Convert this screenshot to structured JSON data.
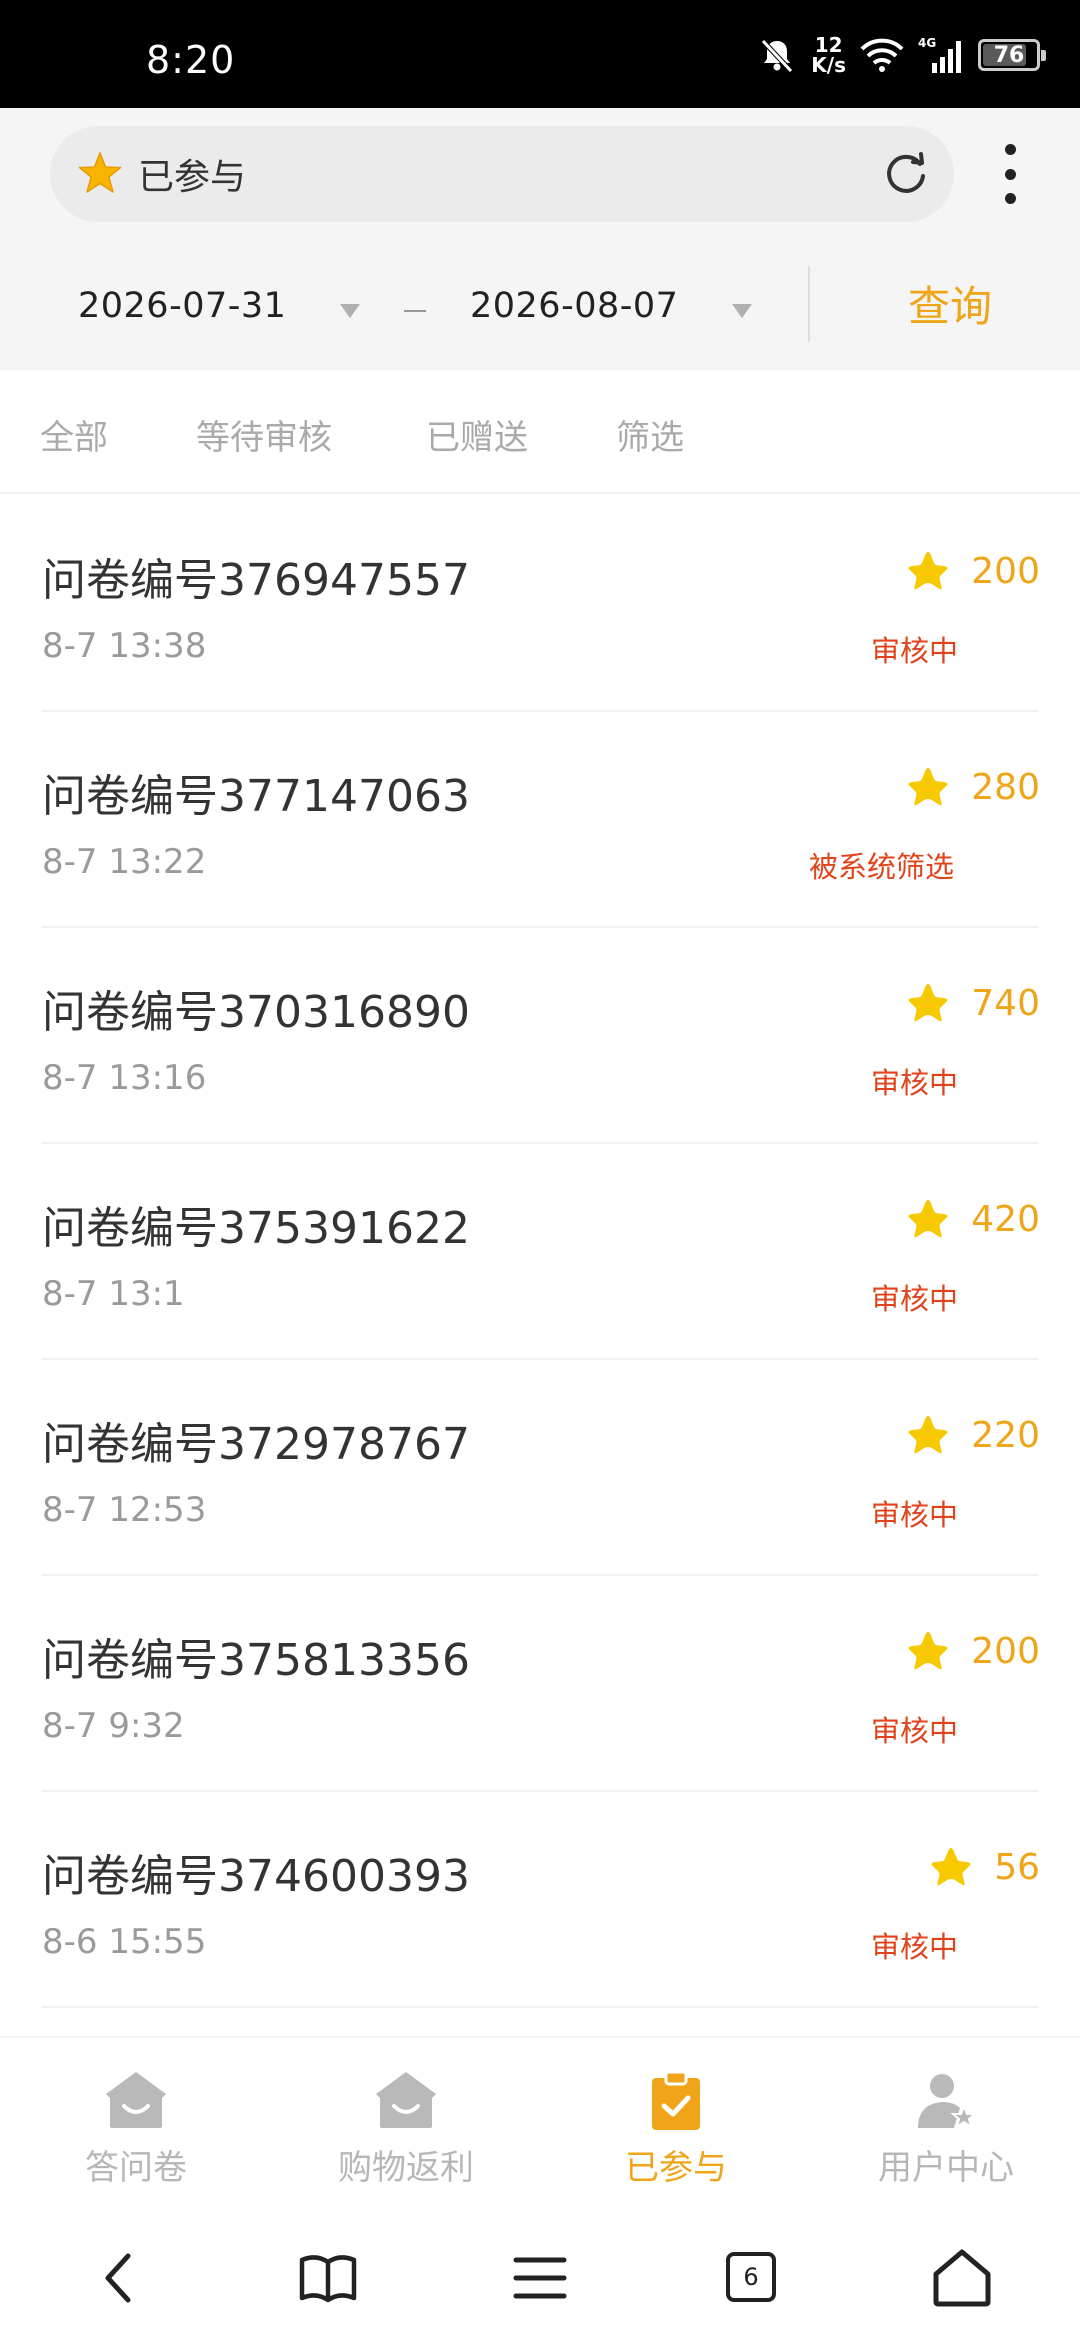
{
  "status_bar": {
    "time": "8:20",
    "net_speed_value": "12",
    "net_speed_unit": "K/s",
    "network": "4G",
    "battery": "76"
  },
  "header": {
    "title": "已参与",
    "title_icon": "star-icon",
    "refresh_icon": "refresh-icon",
    "more_icon": "more-vertical-icon"
  },
  "date_filter": {
    "start": "2026-07-31",
    "end": "2026-08-07",
    "separator": "–",
    "query_label": "查询"
  },
  "tabs": [
    {
      "label": "全部"
    },
    {
      "label": "等待审核"
    },
    {
      "label": "已赠送"
    },
    {
      "label": "筛选"
    }
  ],
  "items": [
    {
      "title": "问卷编号376947557",
      "time": "8-7 13:38",
      "points": "200",
      "status": "审核中"
    },
    {
      "title": "问卷编号377147063",
      "time": "8-7 13:22",
      "points": "280",
      "status": "被系统筛选"
    },
    {
      "title": "问卷编号370316890",
      "time": "8-7 13:16",
      "points": "740",
      "status": "审核中"
    },
    {
      "title": "问卷编号375391622",
      "time": "8-7 13:1",
      "points": "420",
      "status": "审核中"
    },
    {
      "title": "问卷编号372978767",
      "time": "8-7 12:53",
      "points": "220",
      "status": "审核中"
    },
    {
      "title": "问卷编号375813356",
      "time": "8-7 9:32",
      "points": "200",
      "status": "审核中"
    },
    {
      "title": "问卷编号374600393",
      "time": "8-6 15:55",
      "points": "56",
      "status": "审核中"
    }
  ],
  "bottom_nav": [
    {
      "label": "答问卷",
      "icon": "house-smile-icon",
      "active": false
    },
    {
      "label": "购物返利",
      "icon": "house-smile-icon",
      "active": false
    },
    {
      "label": "已参与",
      "icon": "clipboard-check-icon",
      "active": true
    },
    {
      "label": "用户中心",
      "icon": "user-star-icon",
      "active": false
    }
  ],
  "system_nav": {
    "tab_count": "6"
  },
  "colors": {
    "accent": "#f0a519",
    "status_red": "#e0441b",
    "star_yellow": "#f7c900"
  }
}
